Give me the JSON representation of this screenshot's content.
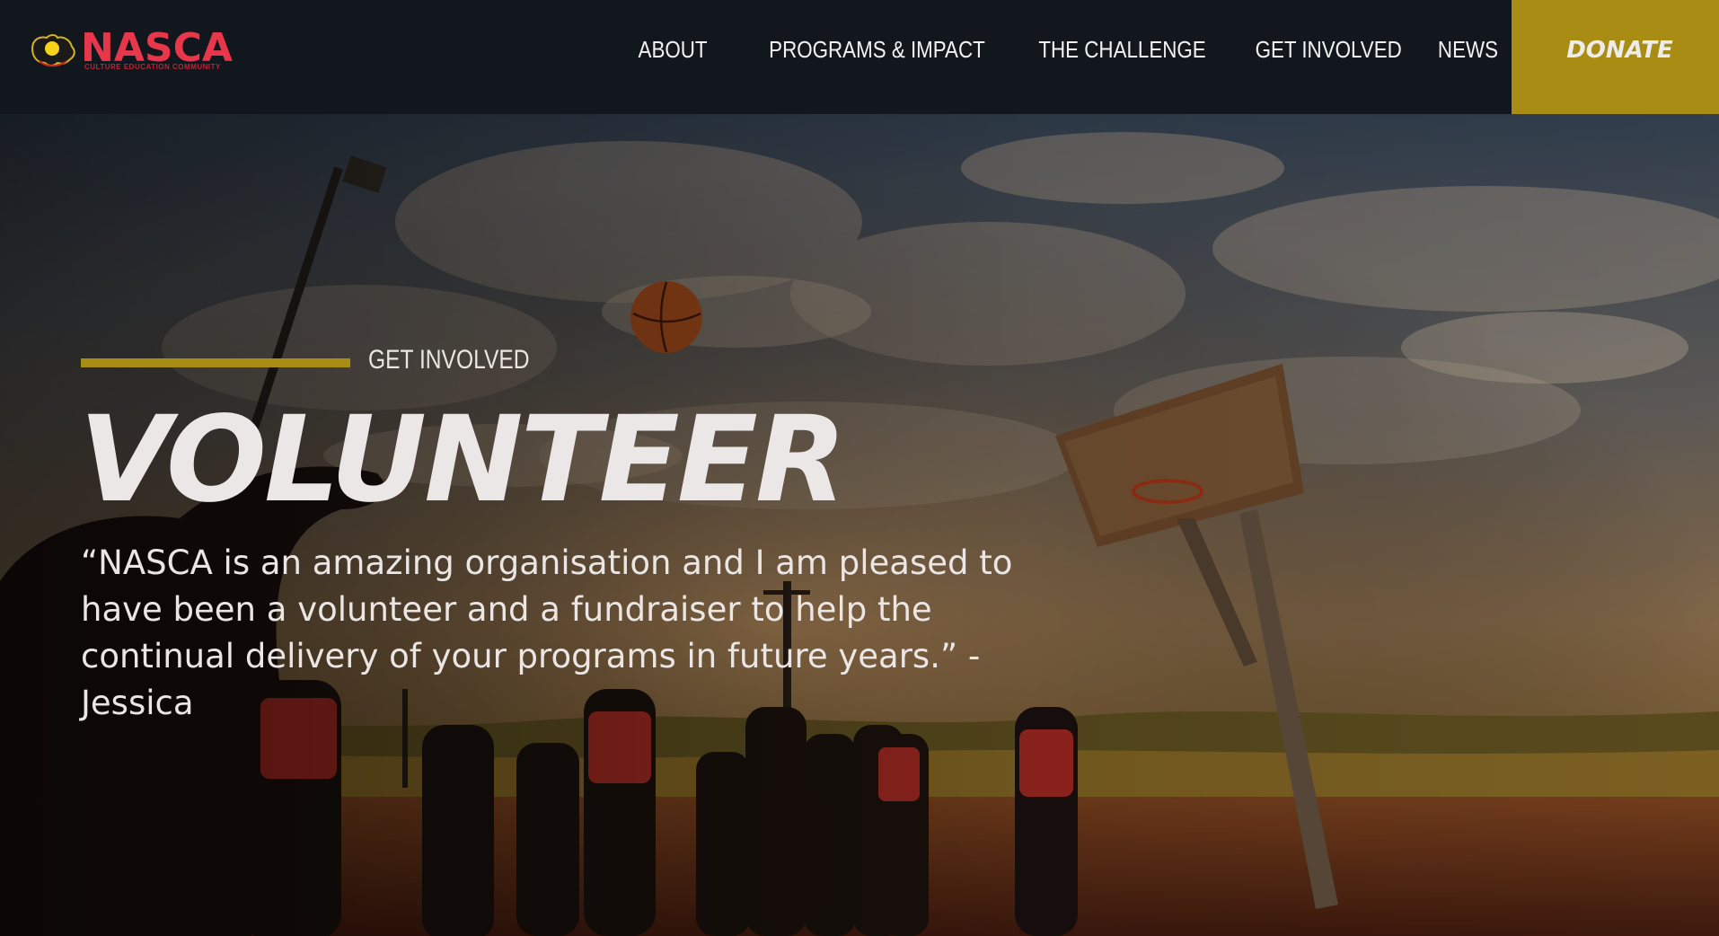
{
  "brand": {
    "name": "NASCA",
    "tagline": "CULTURE EDUCATION COMMUNITY",
    "colors": {
      "logo": "#e8374a",
      "accent": "#a88c13",
      "header_bg": "#11171c"
    }
  },
  "nav": {
    "items": [
      {
        "label": "ABOUT"
      },
      {
        "label": "PROGRAMS & IMPACT"
      },
      {
        "label": "THE CHALLENGE"
      },
      {
        "label": "GET INVOLVED"
      },
      {
        "label": "NEWS"
      }
    ],
    "donate_label": "DONATE"
  },
  "hero": {
    "eyebrow": "GET INVOLVED",
    "title": "VOLUNTEER",
    "quote": "“NASCA is an amazing organisation and I am pleased to have been a volunteer and a fundraiser to help the continual delivery of your programs in future years.” - Jessica"
  }
}
